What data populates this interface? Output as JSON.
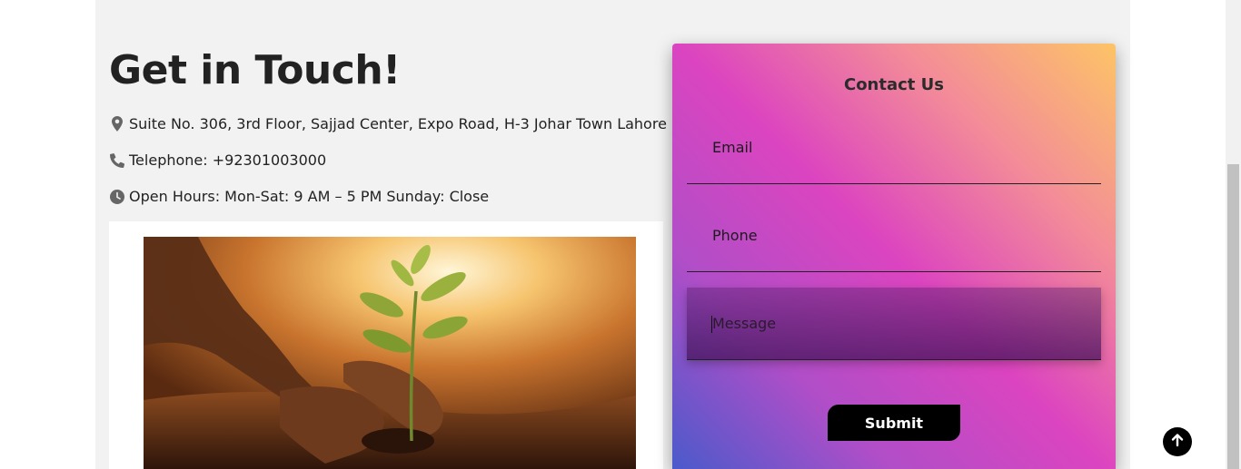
{
  "heading": {
    "title": "Get in Touch!"
  },
  "info": {
    "address": "Suite No. 306, 3rd Floor, Sajjad Center, Expo Road, H-3 Johar Town Lahore",
    "telephone": "Telephone: +92301003000",
    "hours": "Open Hours: Mon-Sat: 9 AM – 5 PM Sunday: Close",
    "icons": [
      "map-marker-icon",
      "phone-icon",
      "clock-icon"
    ],
    "icon_color": "#666666"
  },
  "image": {
    "subject": "hands planting a young sapling in soil"
  },
  "contact_form": {
    "title": "Contact Us",
    "email_placeholder": "Email",
    "phone_placeholder": "Phone",
    "message_placeholder": "Message",
    "submit_label": "Submit",
    "gradient_colors": [
      "#fdc466",
      "#f38c98",
      "#dc44c0",
      "#b04ec8",
      "#4a5acb"
    ]
  },
  "scroll_top": {
    "icon": "arrow-up-icon"
  }
}
